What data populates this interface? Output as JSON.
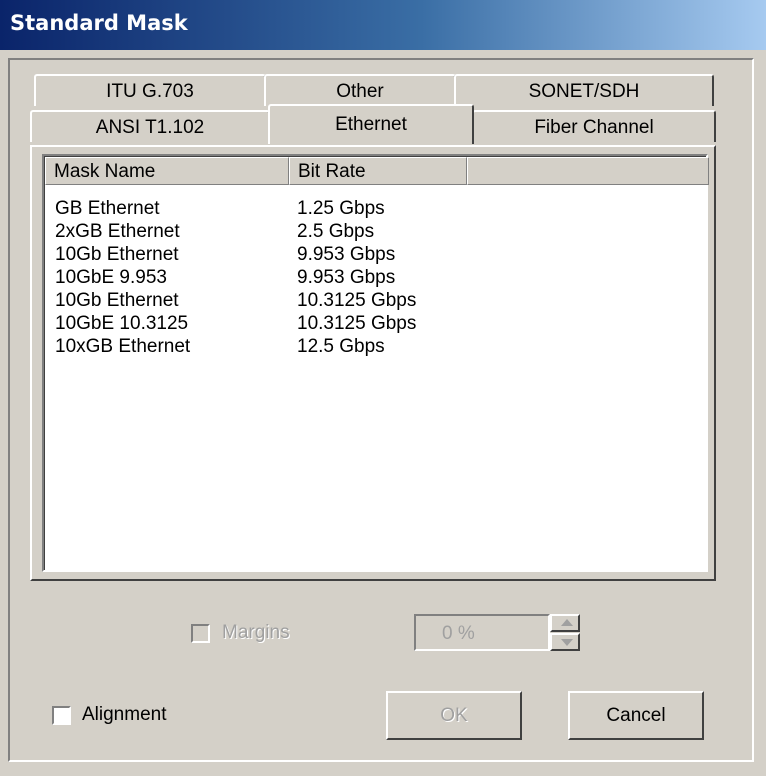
{
  "window": {
    "title": "Standard Mask"
  },
  "tabs": {
    "row_back": [
      "ITU G.703",
      "Other",
      "SONET/SDH"
    ],
    "row_front": [
      "ANSI T1.102",
      "Ethernet",
      "Fiber Channel"
    ],
    "active": "Ethernet"
  },
  "list": {
    "columns": [
      "Mask Name",
      "Bit Rate"
    ],
    "rows": [
      {
        "name": "GB Ethernet",
        "rate": "1.25 Gbps"
      },
      {
        "name": "2xGB Ethernet",
        "rate": "2.5 Gbps"
      },
      {
        "name": "10Gb Ethernet",
        "rate": "9.953 Gbps"
      },
      {
        "name": "10GbE 9.953",
        "rate": "9.953 Gbps"
      },
      {
        "name": "10Gb Ethernet",
        "rate": "10.3125 Gbps"
      },
      {
        "name": "10GbE 10.3125",
        "rate": "10.3125 Gbps"
      },
      {
        "name": "10xGB Ethernet",
        "rate": "12.5 Gbps"
      }
    ]
  },
  "margins": {
    "label": "Margins",
    "checked": false,
    "enabled": false,
    "value": "0 %"
  },
  "alignment": {
    "label": "Alignment",
    "checked": false
  },
  "buttons": {
    "ok": "OK",
    "cancel": "Cancel"
  }
}
